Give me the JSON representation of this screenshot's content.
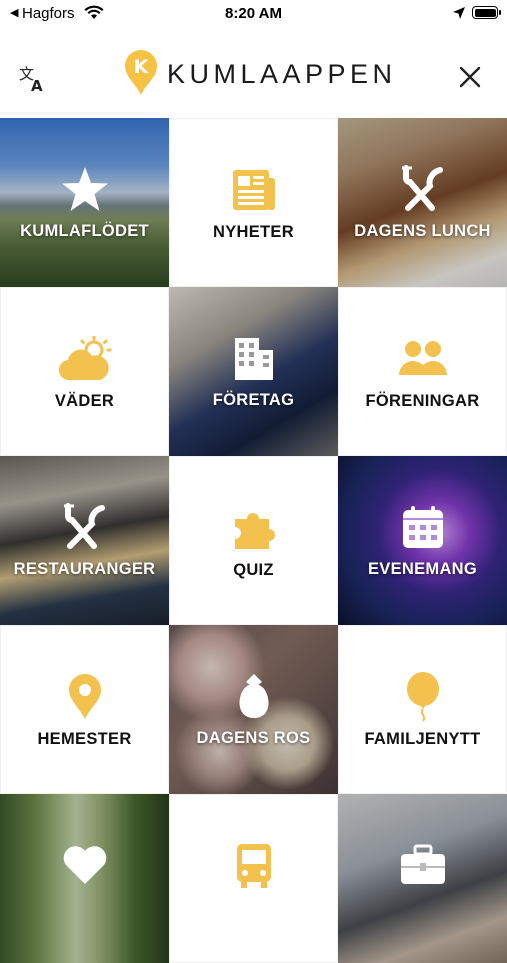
{
  "status_bar": {
    "back_glyph": "◀",
    "carrier": "Hagfors",
    "time": "8:20 AM",
    "icons": [
      "wifi-icon",
      "location-arrow-icon",
      "battery-icon"
    ]
  },
  "header": {
    "logo_letter": "K",
    "title": "KUMLAAPPEN",
    "translate_icon": "translate-icon",
    "close_icon": "close-icon"
  },
  "colors": {
    "accent": "#F2C14E",
    "logo_pin": "#F5C244",
    "label_dark": "#111111",
    "label_light": "#FFFFFF"
  },
  "tiles": [
    {
      "label": "KUMLAFLÖDET",
      "icon": "star-icon",
      "style": "photo"
    },
    {
      "label": "NYHETER",
      "icon": "newspaper-icon",
      "style": "white"
    },
    {
      "label": "DAGENS LUNCH",
      "icon": "fork-knife-icon",
      "style": "photo"
    },
    {
      "label": "VÄDER",
      "icon": "partly-cloudy-icon",
      "style": "white"
    },
    {
      "label": "FÖRETAG",
      "icon": "building-icon",
      "style": "photo"
    },
    {
      "label": "FÖRENINGAR",
      "icon": "people-icon",
      "style": "white"
    },
    {
      "label": "RESTAURANGER",
      "icon": "fork-knife-icon",
      "style": "photo"
    },
    {
      "label": "QUIZ",
      "icon": "puzzle-icon",
      "style": "white"
    },
    {
      "label": "EVENEMANG",
      "icon": "calendar-icon",
      "style": "photo"
    },
    {
      "label": "HEMESTER",
      "icon": "map-pin-icon",
      "style": "white"
    },
    {
      "label": "DAGENS ROS",
      "icon": "flower-icon",
      "style": "photo"
    },
    {
      "label": "FAMILJENYTT",
      "icon": "balloon-icon",
      "style": "white"
    },
    {
      "label": "",
      "icon": "heart-icon",
      "style": "photo"
    },
    {
      "label": "",
      "icon": "bus-icon",
      "style": "white"
    },
    {
      "label": "",
      "icon": "briefcase-icon",
      "style": "photo"
    }
  ]
}
